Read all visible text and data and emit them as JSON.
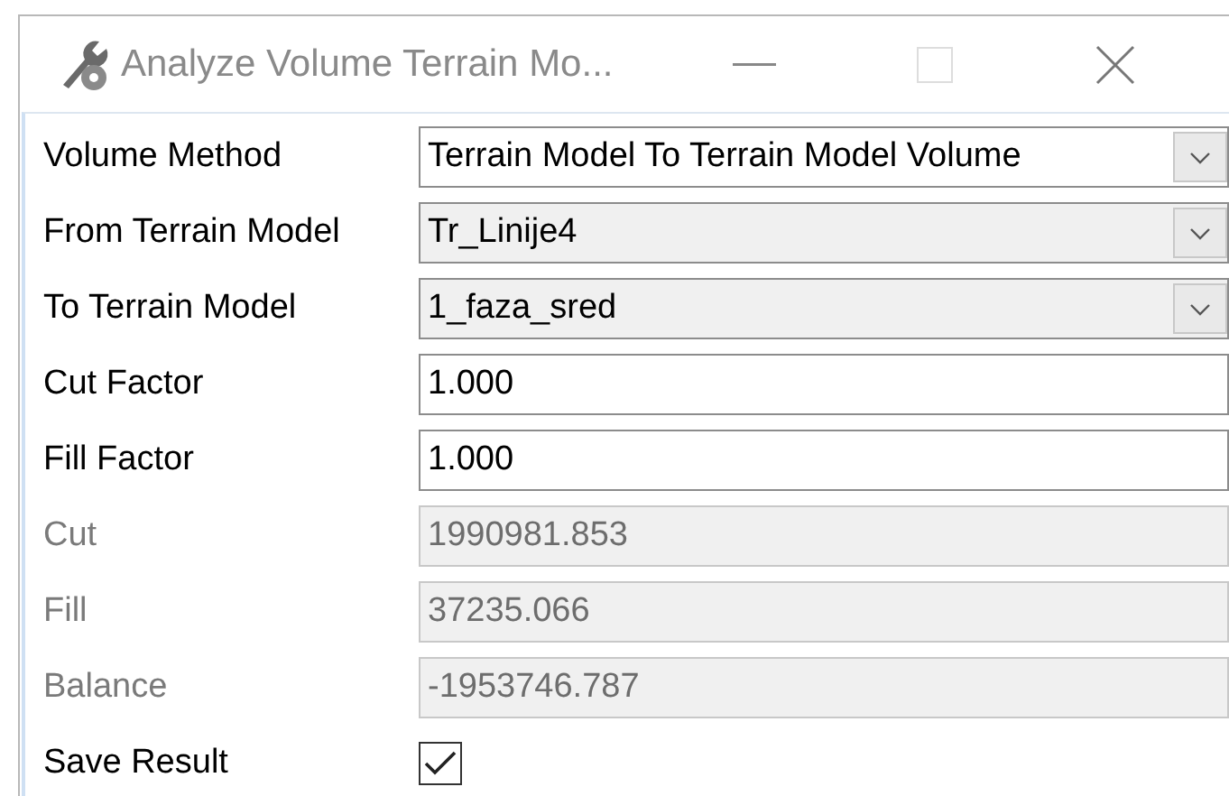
{
  "window": {
    "title": "Analyze Volume Terrain Mo..."
  },
  "fields": [
    {
      "label": "Volume Method",
      "kind": "combo",
      "value": "Terrain Model To Terrain Model Volume",
      "disabled": false,
      "editable": true
    },
    {
      "label": "From Terrain Model",
      "kind": "combo",
      "value": "Tr_Linije4",
      "disabled": false,
      "editable": false
    },
    {
      "label": "To Terrain Model",
      "kind": "combo",
      "value": "1_faza_sred",
      "disabled": false,
      "editable": false
    },
    {
      "label": "Cut Factor",
      "kind": "text",
      "value": "1.000",
      "disabled": false
    },
    {
      "label": "Fill Factor",
      "kind": "text",
      "value": "1.000",
      "disabled": false
    },
    {
      "label": "Cut",
      "kind": "text",
      "value": "1990981.853",
      "disabled": true
    },
    {
      "label": "Fill",
      "kind": "text",
      "value": "37235.066",
      "disabled": true
    },
    {
      "label": "Balance",
      "kind": "text",
      "value": "-1953746.787",
      "disabled": true
    },
    {
      "label": "Save Result",
      "kind": "checkbox",
      "checked": true,
      "disabled": false
    }
  ]
}
